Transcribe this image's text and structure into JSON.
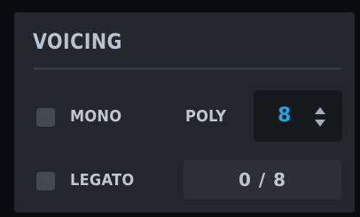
{
  "section": {
    "title": "VOICING"
  },
  "mono": {
    "label": "MONO",
    "checked": false
  },
  "legato": {
    "label": "LEGATO",
    "checked": false
  },
  "poly": {
    "label": "POLY",
    "value": "8",
    "value_color": "#1ea7e8",
    "stepper_icon": "up-down-arrows-icon"
  },
  "voices": {
    "display": "0 / 8"
  },
  "colors": {
    "panel_bg": "#23262a",
    "label_text": "#c1c6cc",
    "title_text": "#b7c3d0",
    "checkbox": "#454a51",
    "accent": "#1ea7e8"
  }
}
